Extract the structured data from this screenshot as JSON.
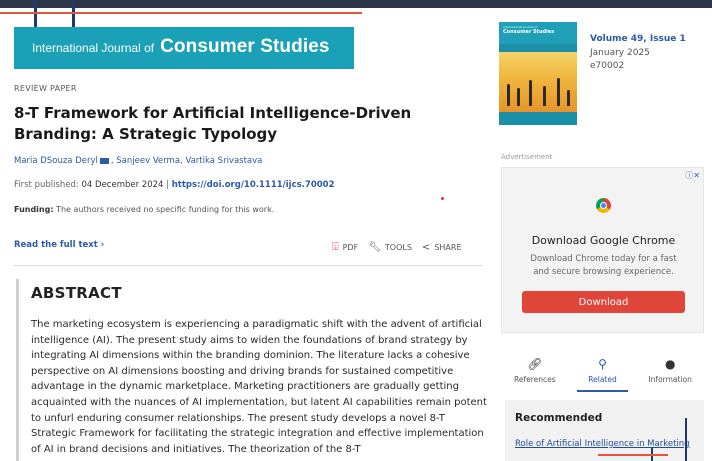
{
  "journal": {
    "banner_prefix": "International Journal of",
    "banner_name": "Consumer Studies",
    "volume_issue": "Volume 49, Issue 1",
    "month_year": "January 2025",
    "article_number": "e70002",
    "cover_small": "International Journal of",
    "cover_title": "Consumer Studies"
  },
  "article": {
    "type": "REVIEW PAPER",
    "title": "8-T Framework for Artificial Intelligence-Driven Branding: A Strategic Typology",
    "authors": {
      "first": "Maria DSouza Deryl",
      "rest": ", Sanjeev Verma, Vartika Srivastava"
    },
    "first_published_label": "First published: ",
    "first_published_date": "04 December 2024",
    "separator": " | ",
    "doi": "https://doi.org/10.1111/ijcs.70002",
    "funding_label": "Funding:",
    "funding_text": " The authors received no specific funding for this work."
  },
  "actions": {
    "read_full_text": "Read the full text ›",
    "pdf": "PDF",
    "tools": "TOOLS",
    "share": "SHARE"
  },
  "abstract": {
    "heading": "ABSTRACT",
    "text": "The marketing ecosystem is experiencing a paradigmatic shift with the advent of artificial intelligence (AI). The present study aims to widen the foundations of brand strategy by integrating AI dimensions within the branding dominion. The literature lacks a cohesive perspective on AI dimensions boosting and driving brands for sustained competitive advantage in the dynamic marketplace. Marketing practitioners are gradually getting acquainted with the nuances of AI implementation, but latent AI capabilities remain potent to unfurl enduring consumer relationships. The present study develops a novel 8-T Strategic Framework for facilitating the strategic integration and effective implementation of AI in brand decisions and initiatives. The theorization of the 8-T"
  },
  "advertisement": {
    "label": "Advertisement",
    "title": "Download Google Chrome",
    "description": "Download Chrome today for a fast and secure browsing experience.",
    "button": "Download"
  },
  "tabs": [
    {
      "label": "References",
      "icon": "link-icon"
    },
    {
      "label": "Related",
      "icon": "network-icon"
    },
    {
      "label": "Information",
      "icon": "info-icon"
    }
  ],
  "recommended": {
    "title": "Recommended",
    "link": "Role of Artificial Intelligence in Marketing"
  },
  "colors": {
    "banner": "#1aa1b8",
    "link": "#2a5aa8",
    "ad_button": "#e0453a"
  }
}
